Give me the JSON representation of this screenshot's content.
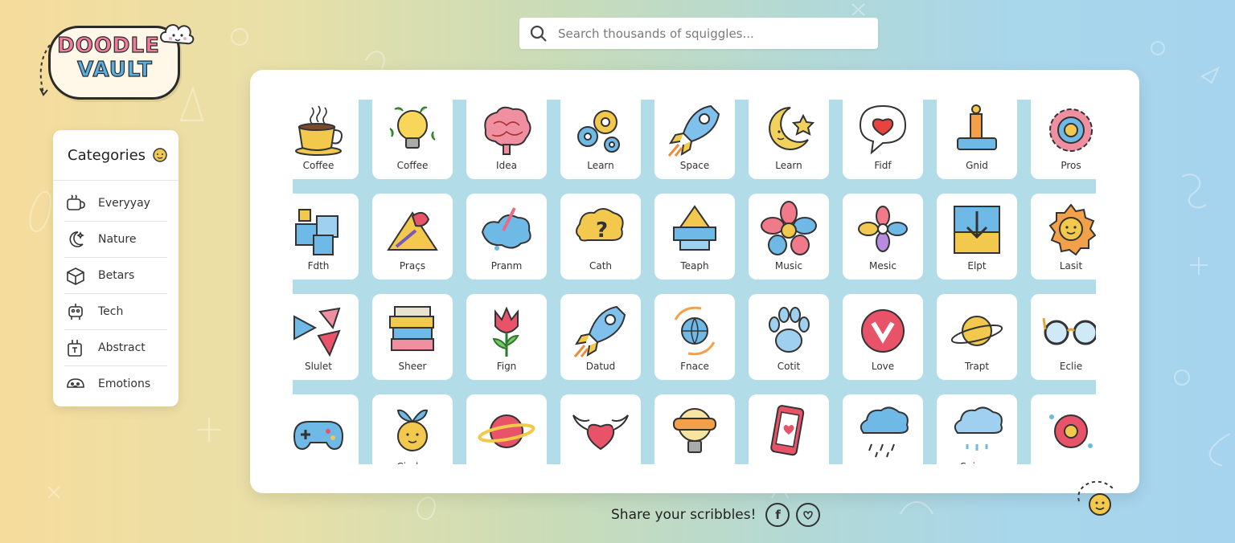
{
  "logo": {
    "line1": "DOODLE",
    "line2": "VAULT"
  },
  "search": {
    "placeholder": "Search thousands of squiggles..."
  },
  "sidebar": {
    "title": "Categories",
    "items": [
      {
        "label": "Everyyay",
        "icon": "mug-icon"
      },
      {
        "label": "Nature",
        "icon": "moon-icon"
      },
      {
        "label": "Betars",
        "icon": "box-icon"
      },
      {
        "label": "Tech",
        "icon": "robot-icon"
      },
      {
        "label": "Abstract",
        "icon": "abstract-icon"
      },
      {
        "label": "Emotions",
        "icon": "emotion-icon"
      }
    ]
  },
  "cards": [
    {
      "label": "Coffee",
      "icon": "coffee-cup-icon"
    },
    {
      "label": "Coffee",
      "icon": "lightbulb-icon"
    },
    {
      "label": "Idea",
      "icon": "brain-icon"
    },
    {
      "label": "Learn",
      "icon": "gears-icon"
    },
    {
      "label": "Space",
      "icon": "rocket-icon"
    },
    {
      "label": "Learn",
      "icon": "moon-star-icon"
    },
    {
      "label": "Fidf",
      "icon": "heart-speech-icon"
    },
    {
      "label": "Gnid",
      "icon": "robot-arm-icon"
    },
    {
      "label": "Pros",
      "icon": "gear-sun-icon"
    },
    {
      "label": "Fdth",
      "icon": "cubes-icon"
    },
    {
      "label": "Praçs",
      "icon": "paint-pyramid-icon"
    },
    {
      "label": "Pranm",
      "icon": "paint-splash-icon"
    },
    {
      "label": "Cath",
      "icon": "question-cloud-icon"
    },
    {
      "label": "Teaph",
      "icon": "shapes-icon"
    },
    {
      "label": "Music",
      "icon": "flower-icon"
    },
    {
      "label": "Mesic",
      "icon": "small-flower-icon"
    },
    {
      "label": "Elpt",
      "icon": "download-frame-icon"
    },
    {
      "label": "Lasit",
      "icon": "sun-face-icon"
    },
    {
      "label": "Slulet",
      "icon": "triangles-icon"
    },
    {
      "label": "Sheer",
      "icon": "books-icon"
    },
    {
      "label": "Fign",
      "icon": "tulip-icon"
    },
    {
      "label": "Datud",
      "icon": "rocket-icon"
    },
    {
      "label": "Fnace",
      "icon": "globe-cycle-icon"
    },
    {
      "label": "Cotit",
      "icon": "paw-icon"
    },
    {
      "label": "Love",
      "icon": "heart-badge-icon"
    },
    {
      "label": "Trapt",
      "icon": "planet-icon"
    },
    {
      "label": "Eclie",
      "icon": "glasses-icon"
    },
    {
      "label": "",
      "icon": "gamepad-icon"
    },
    {
      "label": "Cinder",
      "icon": "sprout-face-icon"
    },
    {
      "label": "",
      "icon": "red-planet-icon"
    },
    {
      "label": "",
      "icon": "winged-heart-icon"
    },
    {
      "label": "",
      "icon": "bulb-bandage-icon"
    },
    {
      "label": "",
      "icon": "phone-heart-icon"
    },
    {
      "label": "",
      "icon": "rain-cloud-icon"
    },
    {
      "label": "Snipen",
      "icon": "cloud-drops-icon"
    },
    {
      "label": "",
      "icon": "flower-disc-icon"
    }
  ],
  "footer": {
    "share_text": "Share your scribbles!",
    "facebook": "f",
    "social2_icon": "heart-circle-icon"
  },
  "colors": {
    "bg_left": "#f6dc9c",
    "bg_right": "#a6d4ee",
    "panel": "#ffffff",
    "grid_gap": "#b2dce8"
  }
}
